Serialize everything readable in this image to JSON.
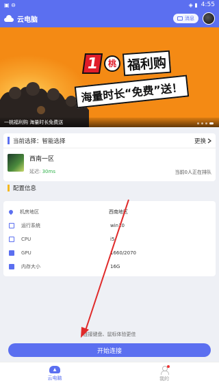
{
  "status_bar": {
    "time": "4:55",
    "left_glyphs": "▣ ⊖",
    "right_glyphs": "◈ ▮"
  },
  "header": {
    "title": "云电脑",
    "message_label": "消息"
  },
  "banner": {
    "badge_one": "1",
    "badge_tao": "桃",
    "headline_1": "福利购",
    "headline_2": "海量时长“免费”送！",
    "caption": "一桃福利购 海量时长免费送"
  },
  "selection": {
    "title": "当前选择：智能选择",
    "change_label": "更换",
    "server_name": "西南一区",
    "latency_label": "延迟:",
    "latency_value": "30ms",
    "queue_text": "当前0人正在排队"
  },
  "config": {
    "title": "配置信息",
    "rows": [
      {
        "icon": "location-pin-icon",
        "label": "机房地区",
        "value": "西南地区"
      },
      {
        "icon": "os-icon",
        "label": "运行系统",
        "value": "win10"
      },
      {
        "icon": "cpu-icon",
        "label": "CPU",
        "value": "i5"
      },
      {
        "icon": "gpu-icon",
        "label": "GPU",
        "value": "1660/2070"
      },
      {
        "icon": "memory-icon",
        "label": "内存大小",
        "value": "16G"
      }
    ]
  },
  "hint": "连接键盘、鼠标体验更佳",
  "connect_label": "开始连接",
  "tabs": [
    {
      "label": "云电脑",
      "icon": "cloud-icon",
      "active": true
    },
    {
      "label": "我的",
      "icon": "user-icon",
      "active": false
    }
  ],
  "colors": {
    "primary": "#5b6ff0",
    "banner": "#f48a14",
    "accent_red": "#e01d2a",
    "latency_green": "#2fb24a"
  }
}
